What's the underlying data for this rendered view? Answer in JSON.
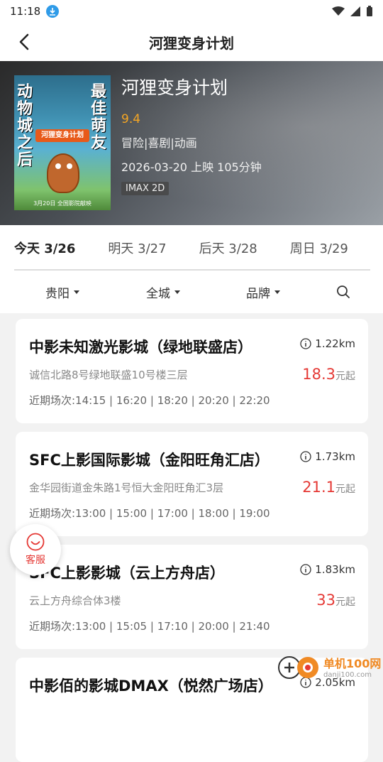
{
  "status": {
    "time": "11:18"
  },
  "nav": {
    "title": "河狸变身计划"
  },
  "movie": {
    "title": "河狸变身计划",
    "rating": "9.4",
    "genre": "冒险|喜剧|动画",
    "release": "2026-03-20 上映 105分钟",
    "format": "IMAX 2D",
    "poster": {
      "left_text": "动物城之后",
      "right_text": "最佳萌友",
      "title_text": "河狸变身计划",
      "date_text": "3月20日 全国影院献映"
    }
  },
  "date_tabs": [
    {
      "label": "今天 3/26",
      "active": true
    },
    {
      "label": "明天 3/27",
      "active": false
    },
    {
      "label": "后天 3/28",
      "active": false
    },
    {
      "label": "周日 3/29",
      "active": false
    }
  ],
  "filters": {
    "city": "贵阳",
    "district": "全城",
    "brand": "品牌"
  },
  "cinemas": [
    {
      "name": "中影未知激光影城（绿地联盛店）",
      "distance": "1.22km",
      "address": "诚信北路8号绿地联盛10号楼三层",
      "price": "18.3",
      "price_unit": "元起",
      "times": "近期场次:14:15 | 16:20 | 18:20 | 20:20 | 22:20"
    },
    {
      "name": "SFC上影国际影城（金阳旺角汇店）",
      "distance": "1.73km",
      "address": "金华园街道金朱路1号恒大金阳旺角汇3层",
      "price": "21.1",
      "price_unit": "元起",
      "times": "近期场次:13:00 | 15:00 | 17:00 | 18:00 | 19:00"
    },
    {
      "name": "SFC上影影城（云上方舟店）",
      "distance": "1.83km",
      "address": "云上方舟综合体3楼",
      "price": "33",
      "price_unit": "元起",
      "times": "近期场次:13:00 | 15:05 | 17:10 | 20:00 | 21:40"
    },
    {
      "name": "中影佰的影城DMAX（悦然广场店）",
      "distance": "2.05km",
      "address": "",
      "price": "",
      "price_unit": "",
      "times": ""
    }
  ],
  "customer_service": {
    "label": "客服"
  },
  "watermark": {
    "line1": "单机100网",
    "line2": "danji100.com"
  },
  "colors": {
    "accent": "#e53935",
    "rating": "#f5a623"
  }
}
